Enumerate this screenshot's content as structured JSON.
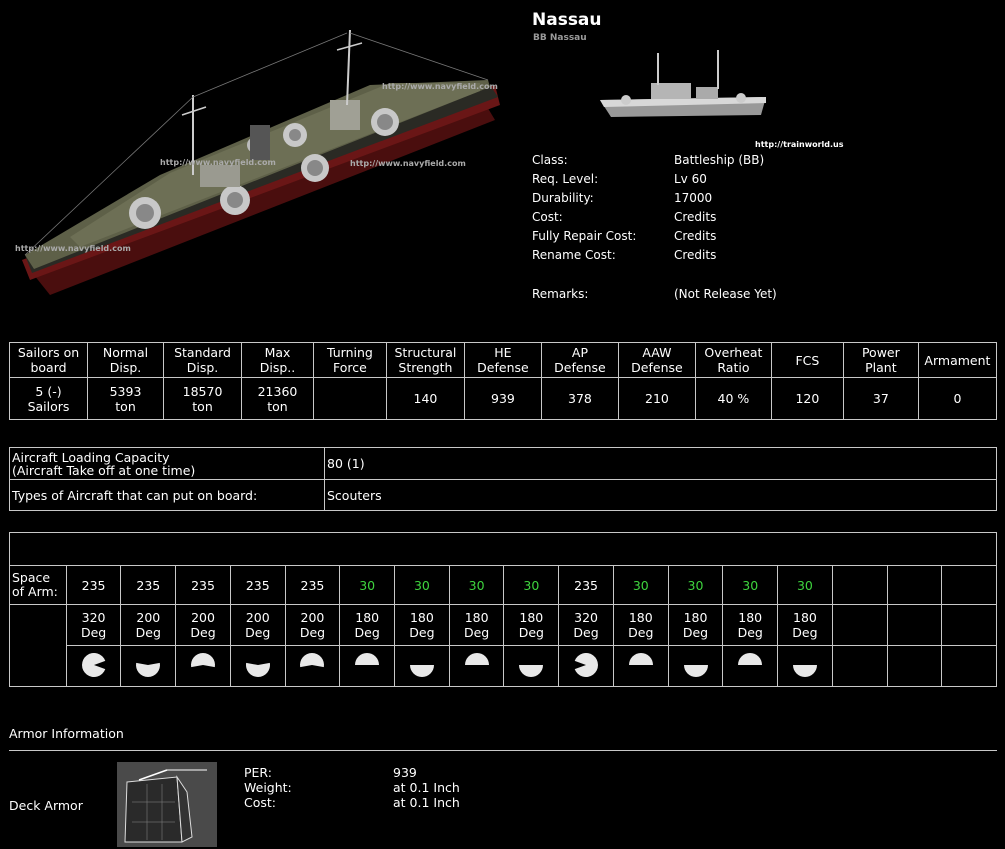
{
  "ship": {
    "name": "Nassau",
    "subtitle": "BB Nassau",
    "thumb_url": "http://trainworld.us",
    "watermark": "http://www.navyfield.com"
  },
  "specs": [
    {
      "label": "Class:",
      "value": "Battleship (BB)"
    },
    {
      "label": "Req. Level:",
      "value": "Lv 60"
    },
    {
      "label": "Durability:",
      "value": "17000"
    },
    {
      "label": "Cost:",
      "value": "Credits"
    },
    {
      "label": "Fully Repair Cost:",
      "value": "Credits"
    },
    {
      "label": "Rename Cost:",
      "value": "Credits"
    },
    {
      "label": "Remarks:",
      "value": "(Not Release Yet)"
    }
  ],
  "stats": {
    "headers": [
      [
        "Sailors on",
        "board"
      ],
      [
        "Normal",
        "Disp."
      ],
      [
        "Standard",
        "Disp."
      ],
      [
        "Max",
        "Disp.."
      ],
      [
        "Turning",
        "Force"
      ],
      [
        "Structural",
        "Strength"
      ],
      [
        "HE",
        "Defense"
      ],
      [
        "AP",
        "Defense"
      ],
      [
        "AAW",
        "Defense"
      ],
      [
        "Overheat",
        "Ratio"
      ],
      [
        "FCS",
        ""
      ],
      [
        "Power",
        "Plant"
      ],
      [
        "Armament",
        ""
      ]
    ],
    "values": [
      [
        "5 (-)",
        "Sailors"
      ],
      [
        "5393",
        "ton"
      ],
      [
        "18570",
        "ton"
      ],
      [
        "21360",
        "ton"
      ],
      [
        "",
        ""
      ],
      [
        "140",
        ""
      ],
      [
        "939",
        ""
      ],
      [
        "378",
        ""
      ],
      [
        "210",
        ""
      ],
      [
        "40 %",
        ""
      ],
      [
        "120",
        ""
      ],
      [
        "37",
        ""
      ],
      [
        "0",
        ""
      ]
    ]
  },
  "aircraft": {
    "capacity_label_1": "Aircraft Loading Capacity",
    "capacity_label_2": "(Aircraft Take off at one time)",
    "capacity_value": "80 (1)",
    "types_label": "Types of Aircraft that can put on board:",
    "types_value": "Scouters"
  },
  "armament": {
    "space_label_1": "Space",
    "space_label_2": "of Arm:",
    "slots": [
      {
        "space": "235",
        "green": false,
        "deg": "320",
        "shape": "pac-right"
      },
      {
        "space": "235",
        "green": false,
        "deg": "200",
        "shape": "bottom-right"
      },
      {
        "space": "235",
        "green": false,
        "deg": "200",
        "shape": "top-left"
      },
      {
        "space": "235",
        "green": false,
        "deg": "200",
        "shape": "bottom-right"
      },
      {
        "space": "235",
        "green": false,
        "deg": "200",
        "shape": "top-left"
      },
      {
        "space": "30",
        "green": true,
        "deg": "180",
        "shape": "top"
      },
      {
        "space": "30",
        "green": true,
        "deg": "180",
        "shape": "bottom"
      },
      {
        "space": "30",
        "green": true,
        "deg": "180",
        "shape": "top"
      },
      {
        "space": "30",
        "green": true,
        "deg": "180",
        "shape": "bottom"
      },
      {
        "space": "235",
        "green": false,
        "deg": "320",
        "shape": "pac-left"
      },
      {
        "space": "30",
        "green": true,
        "deg": "180",
        "shape": "top"
      },
      {
        "space": "30",
        "green": true,
        "deg": "180",
        "shape": "bottom"
      },
      {
        "space": "30",
        "green": true,
        "deg": "180",
        "shape": "top"
      },
      {
        "space": "30",
        "green": true,
        "deg": "180",
        "shape": "bottom"
      },
      {
        "space": "",
        "green": false,
        "deg": "",
        "shape": ""
      },
      {
        "space": "",
        "green": false,
        "deg": "",
        "shape": ""
      },
      {
        "space": "",
        "green": false,
        "deg": "",
        "shape": ""
      }
    ],
    "deg_unit": "Deg"
  },
  "armor": {
    "section_title": "Armor Information",
    "deck_label": "Deck Armor",
    "rows": [
      {
        "label": "PER:",
        "value": "939"
      },
      {
        "label": "Weight:",
        "value": "at 0.1 Inch"
      },
      {
        "label": "Cost:",
        "value": "at 0.1 Inch"
      }
    ]
  },
  "colors": {
    "background": "#000000",
    "text": "#ffffff",
    "border": "#c8c8c8",
    "green": "#3ed43e",
    "hull": "#6b6d52",
    "hull_red": "#5a1212"
  }
}
